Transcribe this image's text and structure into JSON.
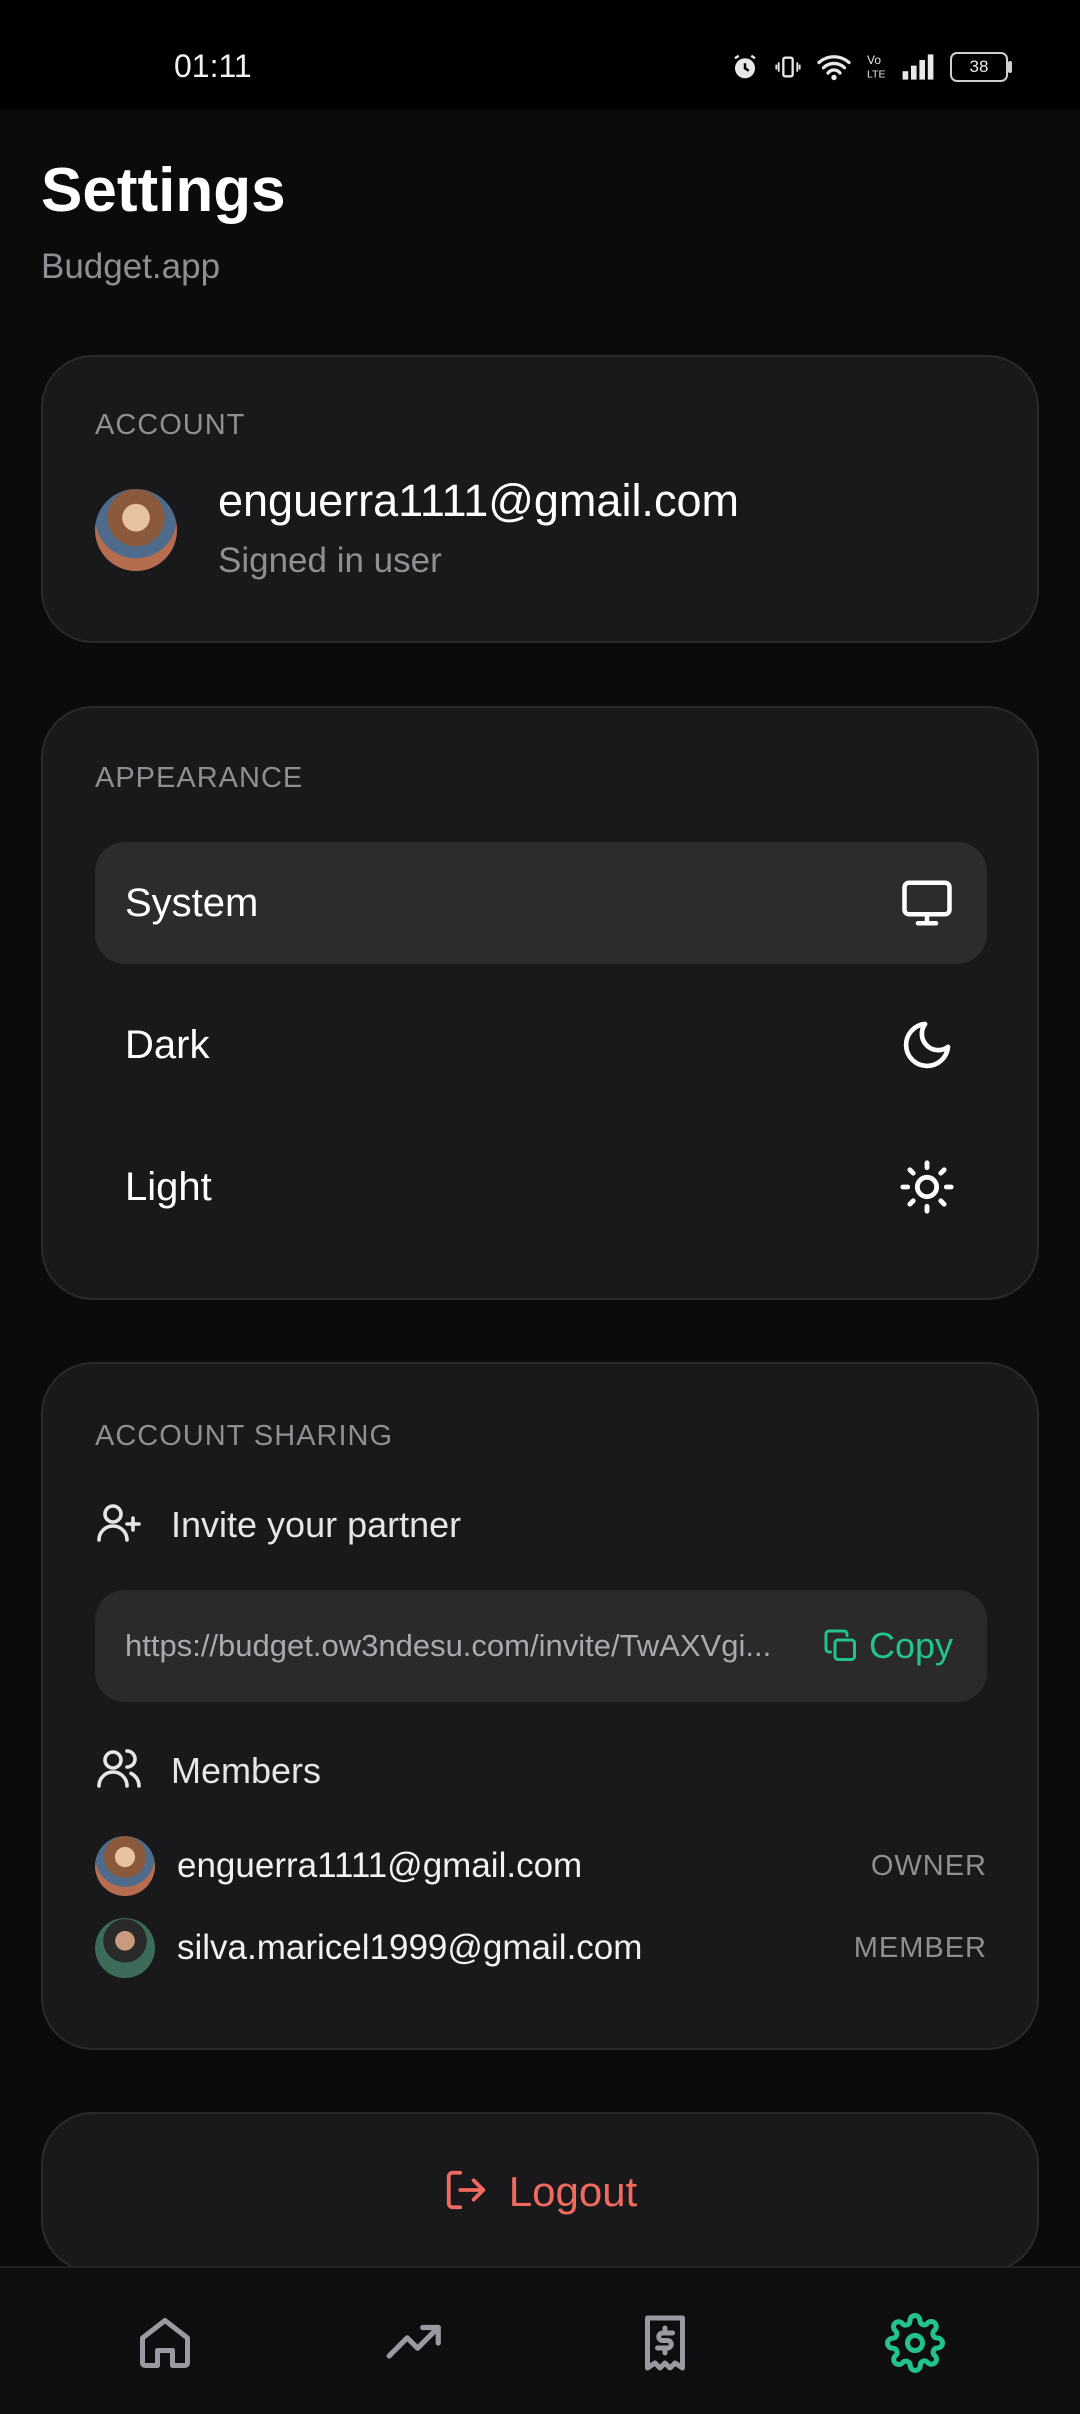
{
  "status_bar": {
    "time": "01:11",
    "battery": "38",
    "icons": [
      "alarm-icon",
      "vibrate-icon",
      "wifi-icon",
      "volte-icon",
      "signal-icon",
      "battery-icon"
    ]
  },
  "header": {
    "title": "Settings",
    "subtitle": "Budget.app"
  },
  "account": {
    "label": "ACCOUNT",
    "email": "enguerra1111@gmail.com",
    "status": "Signed in user"
  },
  "appearance": {
    "label": "APPEARANCE",
    "selected": "System",
    "options": [
      {
        "label": "System",
        "icon": "monitor-icon"
      },
      {
        "label": "Dark",
        "icon": "moon-icon"
      },
      {
        "label": "Light",
        "icon": "sun-icon"
      }
    ]
  },
  "sharing": {
    "label": "ACCOUNT SHARING",
    "invite_label": "Invite your partner",
    "invite_url": "https://budget.ow3ndesu.com/invite/TwAXVgi...",
    "copy_label": "Copy",
    "members_label": "Members",
    "members": [
      {
        "email": "enguerra1111@gmail.com",
        "role": "OWNER"
      },
      {
        "email": "silva.maricel1999@gmail.com",
        "role": "MEMBER"
      }
    ]
  },
  "logout_label": "Logout",
  "bottom_nav": {
    "items": [
      "home-icon",
      "trending-up-icon",
      "receipt-dollar-icon",
      "settings-icon"
    ],
    "active": "settings-icon"
  },
  "colors": {
    "accent": "#22c38e",
    "danger": "#f06a5f",
    "background": "#0b0b0c",
    "card": "#19191b"
  }
}
